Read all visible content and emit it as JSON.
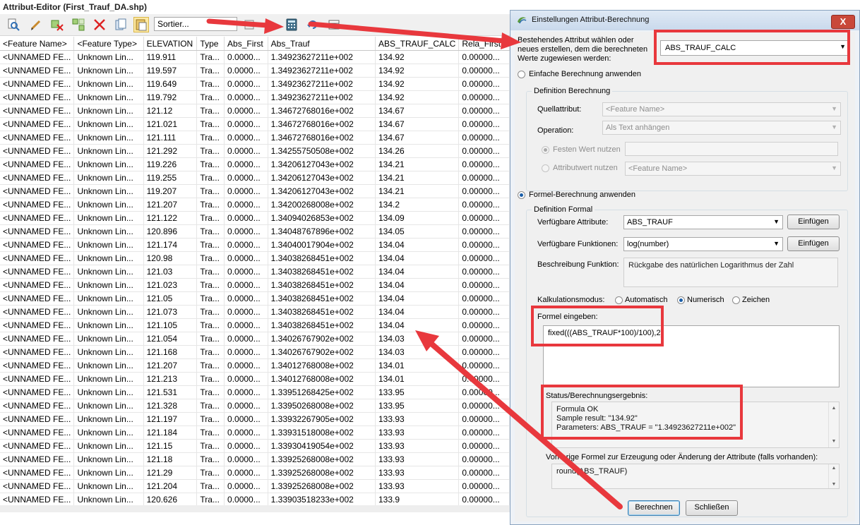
{
  "editor": {
    "title": "Attribut-Editor (First_Trauf_DA.shp)",
    "toolbar": {
      "sort_text": "Sortier...",
      "icons": [
        "search-icon",
        "edit-icon",
        "delete-field-icon",
        "add-field-icon",
        "delete-icon",
        "copy-icon",
        "paste-icon",
        "sort-icon",
        "calculator-icon",
        "refresh-icon",
        "export-icon"
      ]
    },
    "columns": [
      "<Feature Name>",
      "<Feature Type>",
      "ELEVATION",
      "Type",
      "Abs_First",
      "Abs_Trauf",
      "ABS_TRAUF_CALC",
      "Rela_First"
    ],
    "rows": [
      [
        "<UNNAMED FE...",
        "Unknown Lin...",
        "119.911",
        "Tra...",
        "0.0000...",
        "1.34923627211e+002",
        "134.92",
        "0.00000..."
      ],
      [
        "<UNNAMED FE...",
        "Unknown Lin...",
        "119.597",
        "Tra...",
        "0.0000...",
        "1.34923627211e+002",
        "134.92",
        "0.00000..."
      ],
      [
        "<UNNAMED FE...",
        "Unknown Lin...",
        "119.649",
        "Tra...",
        "0.0000...",
        "1.34923627211e+002",
        "134.92",
        "0.00000..."
      ],
      [
        "<UNNAMED FE...",
        "Unknown Lin...",
        "119.792",
        "Tra...",
        "0.0000...",
        "1.34923627211e+002",
        "134.92",
        "0.00000..."
      ],
      [
        "<UNNAMED FE...",
        "Unknown Lin...",
        "121.12",
        "Tra...",
        "0.0000...",
        "1.34672768016e+002",
        "134.67",
        "0.00000..."
      ],
      [
        "<UNNAMED FE...",
        "Unknown Lin...",
        "121.021",
        "Tra...",
        "0.0000...",
        "1.34672768016e+002",
        "134.67",
        "0.00000..."
      ],
      [
        "<UNNAMED FE...",
        "Unknown Lin...",
        "121.111",
        "Tra...",
        "0.0000...",
        "1.34672768016e+002",
        "134.67",
        "0.00000..."
      ],
      [
        "<UNNAMED FE...",
        "Unknown Lin...",
        "121.292",
        "Tra...",
        "0.0000...",
        "1.34255750508e+002",
        "134.26",
        "0.00000..."
      ],
      [
        "<UNNAMED FE...",
        "Unknown Lin...",
        "119.226",
        "Tra...",
        "0.0000...",
        "1.34206127043e+002",
        "134.21",
        "0.00000..."
      ],
      [
        "<UNNAMED FE...",
        "Unknown Lin...",
        "119.255",
        "Tra...",
        "0.0000...",
        "1.34206127043e+002",
        "134.21",
        "0.00000..."
      ],
      [
        "<UNNAMED FE...",
        "Unknown Lin...",
        "119.207",
        "Tra...",
        "0.0000...",
        "1.34206127043e+002",
        "134.21",
        "0.00000..."
      ],
      [
        "<UNNAMED FE...",
        "Unknown Lin...",
        "121.207",
        "Tra...",
        "0.0000...",
        "1.34200268008e+002",
        "134.2",
        "0.00000..."
      ],
      [
        "<UNNAMED FE...",
        "Unknown Lin...",
        "121.122",
        "Tra...",
        "0.0000...",
        "1.34094026853e+002",
        "134.09",
        "0.00000..."
      ],
      [
        "<UNNAMED FE...",
        "Unknown Lin...",
        "120.896",
        "Tra...",
        "0.0000...",
        "1.34048767896e+002",
        "134.05",
        "0.00000..."
      ],
      [
        "<UNNAMED FE...",
        "Unknown Lin...",
        "121.174",
        "Tra...",
        "0.0000...",
        "1.34040017904e+002",
        "134.04",
        "0.00000..."
      ],
      [
        "<UNNAMED FE...",
        "Unknown Lin...",
        "120.98",
        "Tra...",
        "0.0000...",
        "1.34038268451e+002",
        "134.04",
        "0.00000..."
      ],
      [
        "<UNNAMED FE...",
        "Unknown Lin...",
        "121.03",
        "Tra...",
        "0.0000...",
        "1.34038268451e+002",
        "134.04",
        "0.00000..."
      ],
      [
        "<UNNAMED FE...",
        "Unknown Lin...",
        "121.023",
        "Tra...",
        "0.0000...",
        "1.34038268451e+002",
        "134.04",
        "0.00000..."
      ],
      [
        "<UNNAMED FE...",
        "Unknown Lin...",
        "121.05",
        "Tra...",
        "0.0000...",
        "1.34038268451e+002",
        "134.04",
        "0.00000..."
      ],
      [
        "<UNNAMED FE...",
        "Unknown Lin...",
        "121.073",
        "Tra...",
        "0.0000...",
        "1.34038268451e+002",
        "134.04",
        "0.00000..."
      ],
      [
        "<UNNAMED FE...",
        "Unknown Lin...",
        "121.105",
        "Tra...",
        "0.0000...",
        "1.34038268451e+002",
        "134.04",
        "0.00000..."
      ],
      [
        "<UNNAMED FE...",
        "Unknown Lin...",
        "121.054",
        "Tra...",
        "0.0000...",
        "1.34026767902e+002",
        "134.03",
        "0.00000..."
      ],
      [
        "<UNNAMED FE...",
        "Unknown Lin...",
        "121.168",
        "Tra...",
        "0.0000...",
        "1.34026767902e+002",
        "134.03",
        "0.00000..."
      ],
      [
        "<UNNAMED FE...",
        "Unknown Lin...",
        "121.207",
        "Tra...",
        "0.0000...",
        "1.34012768008e+002",
        "134.01",
        "0.00000..."
      ],
      [
        "<UNNAMED FE...",
        "Unknown Lin...",
        "121.213",
        "Tra...",
        "0.0000...",
        "1.34012768008e+002",
        "134.01",
        "0.00000..."
      ],
      [
        "<UNNAMED FE...",
        "Unknown Lin...",
        "121.531",
        "Tra...",
        "0.0000...",
        "1.33951268425e+002",
        "133.95",
        "0.00000..."
      ],
      [
        "<UNNAMED FE...",
        "Unknown Lin...",
        "121.328",
        "Tra...",
        "0.0000...",
        "1.33950268008e+002",
        "133.95",
        "0.00000..."
      ],
      [
        "<UNNAMED FE...",
        "Unknown Lin...",
        "121.197",
        "Tra...",
        "0.0000...",
        "1.33932267905e+002",
        "133.93",
        "0.00000..."
      ],
      [
        "<UNNAMED FE...",
        "Unknown Lin...",
        "121.184",
        "Tra...",
        "0.0000...",
        "1.33931518008e+002",
        "133.93",
        "0.00000..."
      ],
      [
        "<UNNAMED FE...",
        "Unknown Lin...",
        "121.15",
        "Tra...",
        "0.0000...",
        "1.33930419054e+002",
        "133.93",
        "0.00000..."
      ],
      [
        "<UNNAMED FE...",
        "Unknown Lin...",
        "121.18",
        "Tra...",
        "0.0000...",
        "1.33925268008e+002",
        "133.93",
        "0.00000..."
      ],
      [
        "<UNNAMED FE...",
        "Unknown Lin...",
        "121.29",
        "Tra...",
        "0.0000...",
        "1.33925268008e+002",
        "133.93",
        "0.00000..."
      ],
      [
        "<UNNAMED FE...",
        "Unknown Lin...",
        "121.204",
        "Tra...",
        "0.0000...",
        "1.33925268008e+002",
        "133.93",
        "0.00000..."
      ],
      [
        "<UNNAMED FE...",
        "Unknown Lin...",
        "120.626",
        "Tra...",
        "0.0000...",
        "1.33903518233e+002",
        "133.9",
        "0.00000..."
      ]
    ]
  },
  "dialog": {
    "title": "Einstellungen Attribut-Berechnung",
    "close_label": "X",
    "attr_prompt": "Bestehendes Attribut wählen oder neues erstellen, dem die berechneten Werte zugewiesen werden:",
    "attr_value": "ABS_TRAUF_CALC",
    "simple_radio": "Einfache Berechnung anwenden",
    "def_group": "Definition Berechnung",
    "source_label": "Quellattribut:",
    "source_value": "<Feature Name>",
    "operation_label": "Operation:",
    "operation_value": "Als Text anhängen",
    "fixed_radio": "Festen Wert nutzen",
    "attrval_radio": "Attributwert nutzen",
    "attrval_value": "<Feature Name>",
    "formula_radio": "Formel-Berechnung anwenden",
    "formula_group": "Definition Formal",
    "avail_attr_label": "Verfügbare Attribute:",
    "avail_attr_value": "ABS_TRAUF",
    "insert_label": "Einfügen",
    "avail_func_label": "Verfügbare Funktionen:",
    "avail_func_value": "log(number)",
    "desc_label": "Beschreibung Funktion:",
    "desc_value": "Rückgabe des natürlichen Logarithmus der Zahl",
    "calc_mode_label": "Kalkulationsmodus:",
    "mode_auto": "Automatisch",
    "mode_num": "Numerisch",
    "mode_char": "Zeichen",
    "formula_label": "Formel eingeben:",
    "formula_value": "fixed(((ABS_TRAUF*100)/100),2)",
    "status_label": "Status/Berechnungsergebnis:",
    "status_line1": "Formula OK",
    "status_line2": "Sample result: \"134.92\"",
    "status_line3": "Parameters: ABS_TRAUF = \"1.34923627211e+002\"",
    "prev_label": "Vorherige Formel zur Erzeugung oder Änderung der Attribute (falls vorhanden):",
    "prev_value": "round(ABS_TRAUF)",
    "calc_button": "Berechnen",
    "close_button": "Schließen"
  },
  "annotation_color": "#e8383d"
}
